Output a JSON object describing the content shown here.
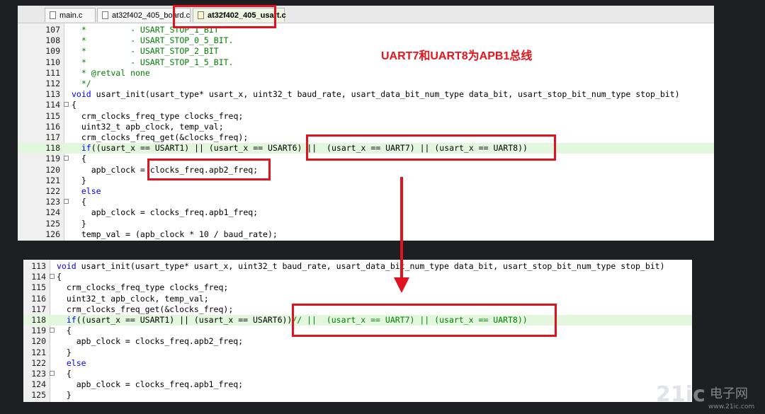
{
  "tabs": [
    {
      "label": "main.c",
      "active": false
    },
    {
      "label": "at32f402_405_board.c",
      "active": false
    },
    {
      "label": "at32f402_405_usart.c",
      "active": true
    }
  ],
  "annotation": "UART7和UART8为APB1总线",
  "top_lines": [
    {
      "num": "107",
      "text": "  *         - USART_STOP_1_BIT",
      "style": "cmt"
    },
    {
      "num": "108",
      "text": "  *         - USART_STOP_0_5_BIT.",
      "style": "cmt"
    },
    {
      "num": "109",
      "text": "  *         - USART_STOP_2_BIT",
      "style": "cmt"
    },
    {
      "num": "110",
      "text": "  *         - USART_STOP_1_5_BIT.",
      "style": "cmt"
    },
    {
      "num": "111",
      "text": "  * @retval none",
      "style": "cmt"
    },
    {
      "num": "112",
      "text": "  */",
      "style": "cmt"
    },
    {
      "num": "113",
      "text": "void usart_init(usart_type* usart_x, uint32_t baud_rate, usart_data_bit_num_type data_bit, usart_stop_bit_num_type stop_bit)",
      "style": ""
    },
    {
      "num": "114",
      "text": "{",
      "style": "",
      "fold": "-"
    },
    {
      "num": "115",
      "text": "  crm_clocks_freq_type clocks_freq;",
      "style": ""
    },
    {
      "num": "116",
      "text": "  uint32_t apb_clock, temp_val;",
      "style": ""
    },
    {
      "num": "117",
      "text": "  crm_clocks_freq_get(&clocks_freq);",
      "style": ""
    },
    {
      "num": "118",
      "text": "  if((usart_x == USART1) || (usart_x == USART6) ||  (usart_x == UART7) || (usart_x == UART8))",
      "style": "",
      "hl": true
    },
    {
      "num": "119",
      "text": "  {",
      "style": "",
      "fold": "-"
    },
    {
      "num": "120",
      "text": "    apb_clock = clocks_freq.apb2_freq;",
      "style": ""
    },
    {
      "num": "121",
      "text": "  }",
      "style": ""
    },
    {
      "num": "122",
      "text": "  else",
      "style": ""
    },
    {
      "num": "123",
      "text": "  {",
      "style": "",
      "fold": "-"
    },
    {
      "num": "124",
      "text": "    apb_clock = clocks_freq.apb1_freq;",
      "style": ""
    },
    {
      "num": "125",
      "text": "  }",
      "style": ""
    },
    {
      "num": "126",
      "text": "  temp_val = (apb_clock * 10 / baud_rate);",
      "style": ""
    }
  ],
  "bottom_lines": [
    {
      "num": "113",
      "text": "void usart_init(usart_type* usart_x, uint32_t baud_rate, usart_data_bit_num_type data_bit, usart_stop_bit_num_type stop_bit)",
      "style": ""
    },
    {
      "num": "114",
      "text": "{",
      "style": "",
      "fold": "-"
    },
    {
      "num": "115",
      "text": "  crm_clocks_freq_type clocks_freq;",
      "style": ""
    },
    {
      "num": "116",
      "text": "  uint32_t apb_clock, temp_val;",
      "style": ""
    },
    {
      "num": "117",
      "text": "  crm_clocks_freq_get(&clocks_freq);",
      "style": ""
    },
    {
      "num": "118",
      "text": "  if((usart_x == USART1) || (usart_x == USART6))// ||  (usart_x == UART7) || (usart_x == UART8))",
      "style": "",
      "hl": true
    },
    {
      "num": "119",
      "text": "  {",
      "style": "",
      "fold": "-"
    },
    {
      "num": "120",
      "text": "    apb_clock = clocks_freq.apb2_freq;",
      "style": ""
    },
    {
      "num": "121",
      "text": "  }",
      "style": ""
    },
    {
      "num": "122",
      "text": "  else",
      "style": ""
    },
    {
      "num": "123",
      "text": "  {",
      "style": "",
      "fold": "-"
    },
    {
      "num": "124",
      "text": "    apb_clock = clocks_freq.apb1_freq;",
      "style": ""
    },
    {
      "num": "125",
      "text": "  }",
      "style": ""
    }
  ],
  "watermark": {
    "brand": "21ic",
    "cn": "电子网",
    "url": "www.21ic.com"
  },
  "colors": {
    "highlight": "#e3f7df",
    "annotation_red": "#e8131b",
    "comment": "#008000",
    "keyword": "#0000ff"
  }
}
